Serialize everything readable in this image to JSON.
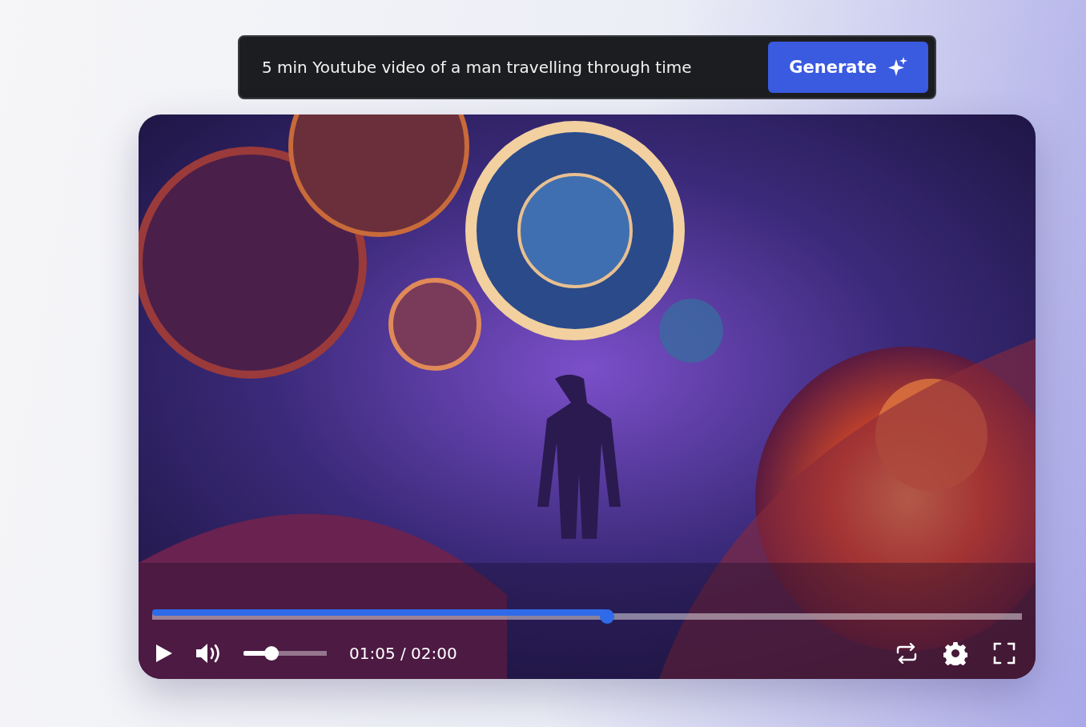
{
  "prompt": {
    "value": "5 min Youtube video of a man travelling through time"
  },
  "generate_button": {
    "label": "Generate"
  },
  "player": {
    "progress": {
      "level": 0.523
    },
    "volume": {
      "level": 0.34
    },
    "time": "01:05 / 02:00"
  }
}
